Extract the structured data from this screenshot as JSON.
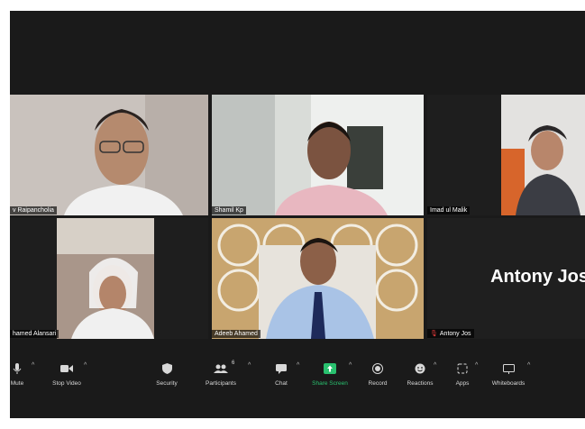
{
  "participants": [
    {
      "name": "v Raipancholia"
    },
    {
      "name": "Shamil Kp"
    },
    {
      "name": "Imad ul Malik"
    },
    {
      "name": "hamed Alansari"
    },
    {
      "name": "Adeeb Ahamed"
    },
    {
      "name": "Antony Jos",
      "display_text": "Antony Jos"
    }
  ],
  "toolbar": {
    "mute_label": "Mute",
    "stop_video_label": "Stop Video",
    "security_label": "Security",
    "participants_label": "Participants",
    "participants_count": "6",
    "chat_label": "Chat",
    "share_screen_label": "Share Screen",
    "record_label": "Record",
    "reactions_label": "Reactions",
    "apps_label": "Apps",
    "whiteboards_label": "Whiteboards"
  },
  "colors": {
    "active_speaker_border": "#d4e64a",
    "share_screen_green": "#29c16f",
    "muted_red": "#e23a3a"
  }
}
